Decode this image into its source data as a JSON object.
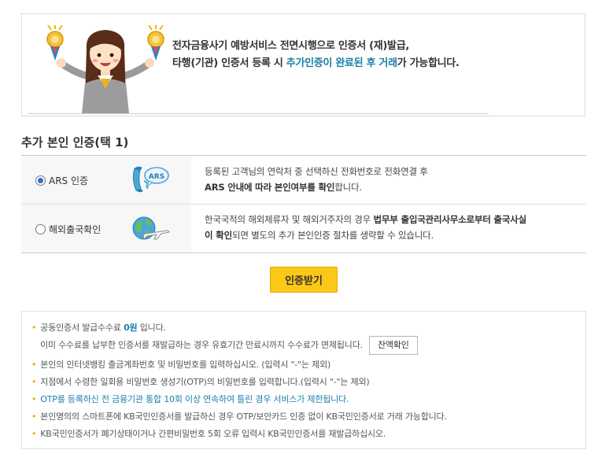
{
  "banner": {
    "line1": "전자금융사기 예방서비스 전면시행으로 인증서 (재)발급,",
    "line2_pre": "타행(기관) 인증서 등록 시 ",
    "line2_hl": "추가인증이 완료된 후 거래",
    "line2_post": "가 가능합니다."
  },
  "section_title": "추가 본인 인증(택 1)",
  "options": [
    {
      "label": "ARS 인증",
      "checked": true,
      "icon": "phone-ars-icon",
      "icon_text": "ARS",
      "desc_line1": "등록된 고객님의 연락처 중 선택하신 전화번호로 전화연결 후",
      "desc_line2_bold": "ARS 안내에 따라 본인여부를 확인",
      "desc_line2_post": "합니다."
    },
    {
      "label": "해외출국확인",
      "checked": false,
      "icon": "globe-airplane-icon",
      "desc_line1_pre": "한국국적의 해외체류자 및 해외거주자의 경우 ",
      "desc_line1_bold": "법무부 출입국관리사무소로부터 출국사실",
      "desc_line2_bold": "이 확인",
      "desc_line2_post": "되면 별도의 추가 본인인증 절차를 생략할 수 있습니다."
    }
  ],
  "primary_button": "인증받기",
  "notices": {
    "item1_pre": "공동인증서 발급수수료 ",
    "item1_fee": "0원",
    "item1_post": " 입니다.",
    "item1_line2": "이미 수수료를 납부한 인증서를 재발급하는 경우 유효기간 만료시까지 수수료가 면제됩니다.",
    "balance_button": "잔액확인",
    "item2": "본인의 인터넷뱅킹 출금계좌번호 및 비밀번호를 입력하십시오. (입력시 \"-\"는 제외)",
    "item3": "지점에서 수령한 일회용 비밀번호 생성기(OTP)의 비밀번호를 입력합니다.(입력시 \"-\"는 제외)",
    "item4": "OTP를 등록하신 전 금융기관 통합 10회 이상 연속하여 틀린 경우 서비스가 제한됩니다.",
    "item5": "본인명의의 스마트폰에 KB국민인증서를 발급하신 경우 OTP/보안카드 인증 없이 KB국민인증서로 거래 가능합니다.",
    "item6": "KB국민인증서가 폐기상태이거나 간편비밀번호 5회 오류 입력시 KB국민인증서를 재발급하십시오."
  },
  "colors": {
    "accent": "#1a7fa8",
    "button_yellow": "#fcc818",
    "bullet": "#f0a500",
    "radio_checked": "#2c6ed1"
  }
}
